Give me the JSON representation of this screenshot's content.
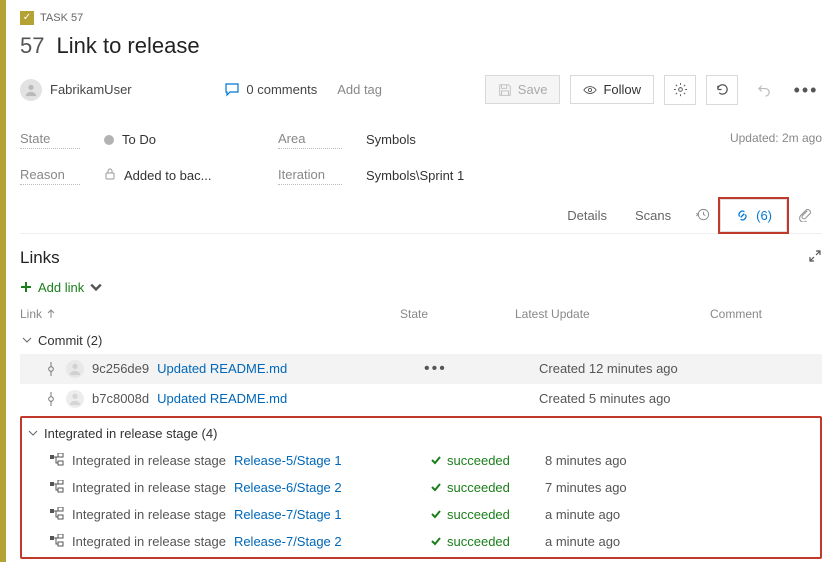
{
  "header": {
    "badge": "TASK 57",
    "number": "57",
    "title": "Link to release",
    "user": "FabrikamUser",
    "comments": "0 comments",
    "add_tag": "Add tag",
    "save": "Save",
    "follow": "Follow",
    "updated": "Updated: 2m ago"
  },
  "fields": {
    "state_lbl": "State",
    "state_val": "To Do",
    "area_lbl": "Area",
    "area_val": "Symbols",
    "reason_lbl": "Reason",
    "reason_val": "Added to bac...",
    "iteration_lbl": "Iteration",
    "iteration_val": "Symbols\\Sprint 1"
  },
  "tabs": {
    "details": "Details",
    "scans": "Scans",
    "links_count": "(6)"
  },
  "section": {
    "title": "Links",
    "add_link": "Add link"
  },
  "headers": {
    "link": "Link",
    "state": "State",
    "latest": "Latest Update",
    "comment": "Comment"
  },
  "groups": {
    "commit": "Commit (2)",
    "stage": "Integrated in release stage (4)"
  },
  "commits": [
    {
      "hash": "9c256de9",
      "msg": "Updated README.md",
      "time": "Created 12 minutes ago",
      "hover": true
    },
    {
      "hash": "b7c8008d",
      "msg": "Updated README.md",
      "time": "Created 5 minutes ago",
      "hover": false
    }
  ],
  "stages": [
    {
      "prefix": "Integrated in release stage",
      "name": "Release-5/Stage 1",
      "status": "succeeded",
      "time": "8 minutes ago"
    },
    {
      "prefix": "Integrated in release stage",
      "name": "Release-6/Stage 2",
      "status": "succeeded",
      "time": "7 minutes ago"
    },
    {
      "prefix": "Integrated in release stage",
      "name": "Release-7/Stage 1",
      "status": "succeeded",
      "time": "a minute ago"
    },
    {
      "prefix": "Integrated in release stage",
      "name": "Release-7/Stage 2",
      "status": "succeeded",
      "time": "a minute ago"
    }
  ]
}
